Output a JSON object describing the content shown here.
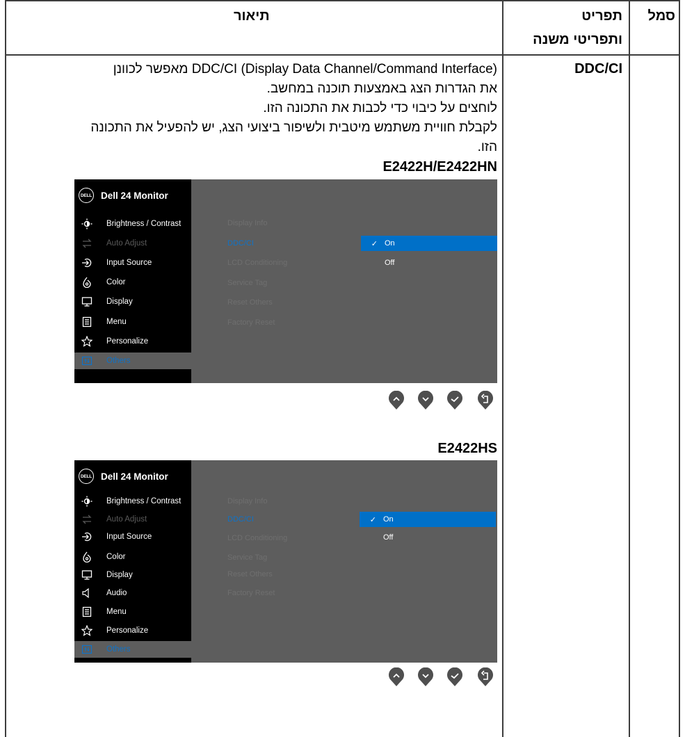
{
  "table": {
    "headers": {
      "icon": "סמל",
      "item_line1": "תפריט",
      "item_line2": "ותפריטי משנה",
      "description": "תיאור"
    },
    "row": {
      "item": "DDC/CI",
      "description_lines": [
        "DDC/CI (Display Data Channel/Command Interface) מאפשר לכוונן",
        "את הגדרות הצג באמצעות תוכנה במחשב.",
        "לוחצים על כיבוי כדי לכבות את התכונה הזו.",
        "לקבלת חוויית משתמש מיטבית ולשיפור ביצועי הצג, יש להפעיל את התכונה",
        "הזו."
      ]
    }
  },
  "osd1": {
    "model": "E2422H/E2422HN",
    "logo_text": "DELL",
    "title": "Dell 24 Monitor",
    "menu": [
      {
        "label": "Brightness / Contrast",
        "icon": "brightness-icon"
      },
      {
        "label": "Auto Adjust",
        "icon": "auto-adjust-icon"
      },
      {
        "label": "Input Source",
        "icon": "input-source-icon"
      },
      {
        "label": "Color",
        "icon": "color-icon"
      },
      {
        "label": "Display",
        "icon": "display-icon"
      },
      {
        "label": "Menu",
        "icon": "menu-icon"
      },
      {
        "label": "Personalize",
        "icon": "personalize-icon"
      },
      {
        "label": "Others",
        "icon": "others-icon"
      }
    ],
    "submenu": [
      "Display Info",
      "DDC/CI",
      "LCD Conditioning",
      "Service Tag",
      "Reset Others",
      "Factory Reset"
    ],
    "options": {
      "on": "On",
      "off": "Off",
      "check": "✓"
    }
  },
  "osd2": {
    "model": "E2422HS",
    "logo_text": "DELL",
    "title": "Dell 24 Monitor",
    "menu": [
      {
        "label": "Brightness / Contrast",
        "icon": "brightness-icon"
      },
      {
        "label": "Auto Adjust",
        "icon": "auto-adjust-icon"
      },
      {
        "label": "Input Source",
        "icon": "input-source-icon"
      },
      {
        "label": "Color",
        "icon": "color-icon"
      },
      {
        "label": "Display",
        "icon": "display-icon"
      },
      {
        "label": "Audio",
        "icon": "audio-icon"
      },
      {
        "label": "Menu",
        "icon": "menu-icon"
      },
      {
        "label": "Personalize",
        "icon": "personalize-icon"
      },
      {
        "label": "Others",
        "icon": "others-icon"
      }
    ],
    "submenu": [
      "Display Info",
      "DDC/CI",
      "LCD Conditioning",
      "Service Tag",
      "Reset Others",
      "Factory Reset"
    ],
    "options": {
      "on": "On",
      "off": "Off",
      "check": "✓"
    }
  },
  "colors": {
    "highlight": "#0070c8",
    "osd_panel": "#5d5d5d",
    "osd_menu": "#000000",
    "selected_text": "#0f73c8"
  },
  "buttons": [
    "up-button",
    "down-button",
    "confirm-button",
    "back-button"
  ]
}
